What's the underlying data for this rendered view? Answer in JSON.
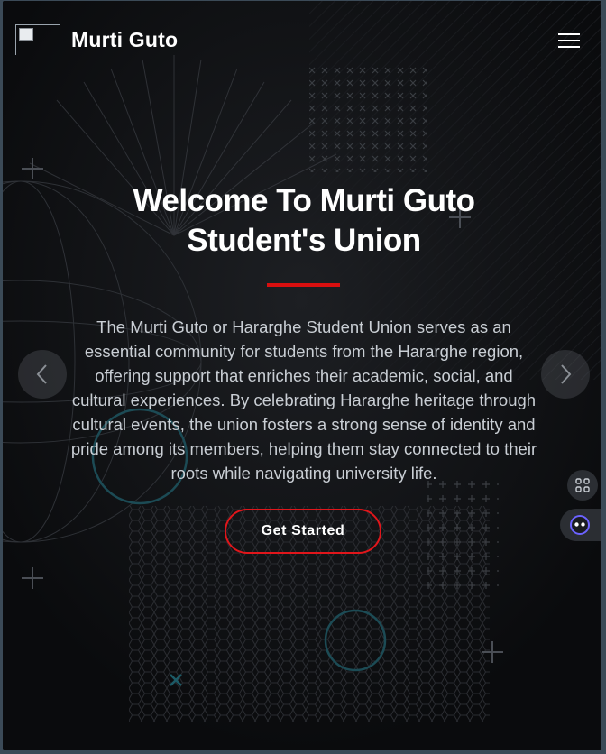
{
  "header": {
    "brand": "Murti Guto",
    "logo_icon": "broken-image-icon",
    "menu_icon": "hamburger-menu-icon"
  },
  "hero": {
    "title_line1": "Welcome To Murti Guto",
    "title_line2": "Student's Union",
    "description": "The Murti Guto or Hararghe Student Union serves as an essential community for students from the Hararghe region, offering support that enriches their academic, social, and cultural experiences. By celebrating Hararghe heritage through cultural events, the union fosters a strong sense of identity and pride among its members, helping them stay connected to their roots while navigating university life.",
    "cta_label": "Get Started"
  },
  "carousel": {
    "prev_icon": "chevron-left-icon",
    "next_icon": "chevron-right-icon"
  },
  "widgets": {
    "apps_icon": "apps-grid-icon",
    "assistant_icon": "assistant-bot-icon"
  },
  "colors": {
    "accent": "#d90f0f",
    "background": "#0c0d10",
    "text": "#ffffff"
  }
}
